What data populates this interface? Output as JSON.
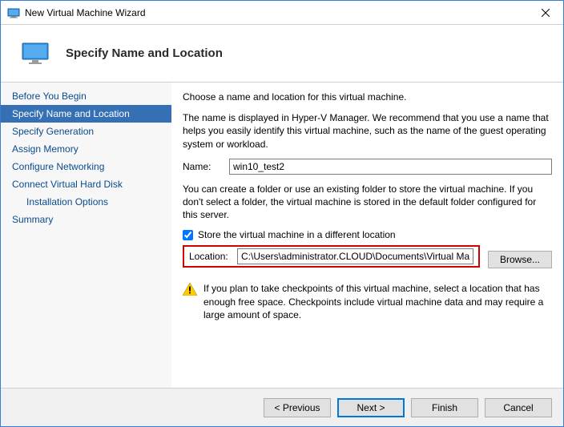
{
  "window": {
    "title": "New Virtual Machine Wizard"
  },
  "header": {
    "title": "Specify Name and Location"
  },
  "sidebar": {
    "items": [
      {
        "label": "Before You Begin",
        "selected": false,
        "indent": false
      },
      {
        "label": "Specify Name and Location",
        "selected": true,
        "indent": false
      },
      {
        "label": "Specify Generation",
        "selected": false,
        "indent": false
      },
      {
        "label": "Assign Memory",
        "selected": false,
        "indent": false
      },
      {
        "label": "Configure Networking",
        "selected": false,
        "indent": false
      },
      {
        "label": "Connect Virtual Hard Disk",
        "selected": false,
        "indent": false
      },
      {
        "label": "Installation Options",
        "selected": false,
        "indent": true
      },
      {
        "label": "Summary",
        "selected": false,
        "indent": false
      }
    ]
  },
  "main": {
    "intro": "Choose a name and location for this virtual machine.",
    "name_desc": "The name is displayed in Hyper-V Manager. We recommend that you use a name that helps you easily identify this virtual machine, such as the name of the guest operating system or workload.",
    "name_label": "Name:",
    "name_value": "win10_test2",
    "folder_desc": "You can create a folder or use an existing folder to store the virtual machine. If you don't select a folder, the virtual machine is stored in the default folder configured for this server.",
    "store_checkbox_label": "Store the virtual machine in a different location",
    "store_checked": true,
    "location_label": "Location:",
    "location_value": "C:\\Users\\administrator.CLOUD\\Documents\\Virtual Machines\\",
    "browse_label": "Browse...",
    "warning": "If you plan to take checkpoints of this virtual machine, select a location that has enough free space. Checkpoints include virtual machine data and may require a large amount of space."
  },
  "footer": {
    "previous": "< Previous",
    "next": "Next >",
    "finish": "Finish",
    "cancel": "Cancel"
  }
}
